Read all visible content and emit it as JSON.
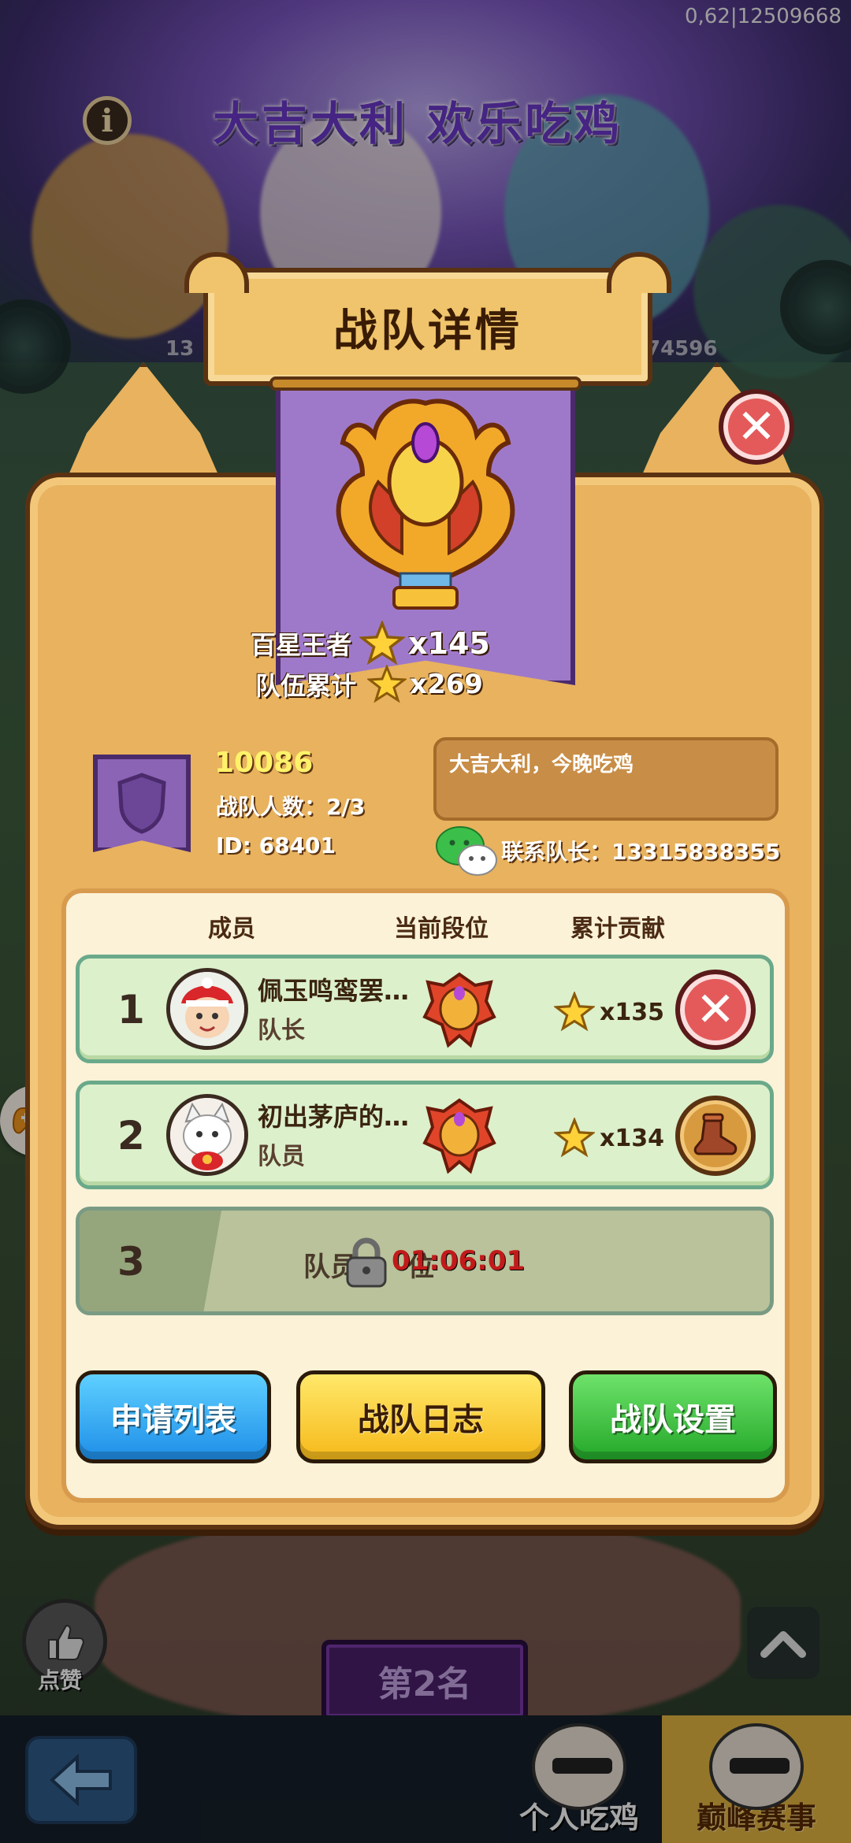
{
  "status": {
    "debug": "0,62|12509668"
  },
  "background": {
    "banner_title": "大吉大利 欢乐吃鸡",
    "info_icon": "i",
    "left_number": "13",
    "right_number": "74596",
    "like_label": "点赞",
    "rank_plate": "第2名"
  },
  "bottom_nav": {
    "back_icon": "arrow-left-icon",
    "tabs": [
      {
        "label": "个人吃鸡",
        "active": false
      },
      {
        "label": "巅峰赛事",
        "active": true
      }
    ]
  },
  "dialog": {
    "title": "战队详情",
    "stats": {
      "star_king_label": "百星王者",
      "star_king_value": "x145",
      "team_total_label": "队伍累计",
      "team_total_value": "x269"
    },
    "team": {
      "name": "10086",
      "members_line": "战队人数：2/3",
      "id_line": "ID: 68401",
      "motto": "大吉大利，今晚吃鸡",
      "contact_line": "联系队长：13315838355"
    },
    "columns": [
      "成员",
      "当前段位",
      "累计贡献"
    ],
    "members": [
      {
        "index": "1",
        "name": "佩玉鸣鸾罢…",
        "role": "队长",
        "contribution": "x135",
        "action": "kick"
      },
      {
        "index": "2",
        "name": "初出茅庐的…",
        "role": "队员",
        "contribution": "x134",
        "action": "boot"
      }
    ],
    "locked_slot": {
      "index": "3",
      "label": "队员",
      "tail": "位",
      "timer": "01:06:01"
    },
    "buttons": {
      "apply": "申请列表",
      "log": "战队日志",
      "settings": "战队设置"
    }
  },
  "colors": {
    "panel": "#e8b25e",
    "row_green": "#dcf0cb",
    "danger": "#e45a5a",
    "blue": "#1e8ee8",
    "yellow": "#f6b91a",
    "green": "#24a82a"
  }
}
